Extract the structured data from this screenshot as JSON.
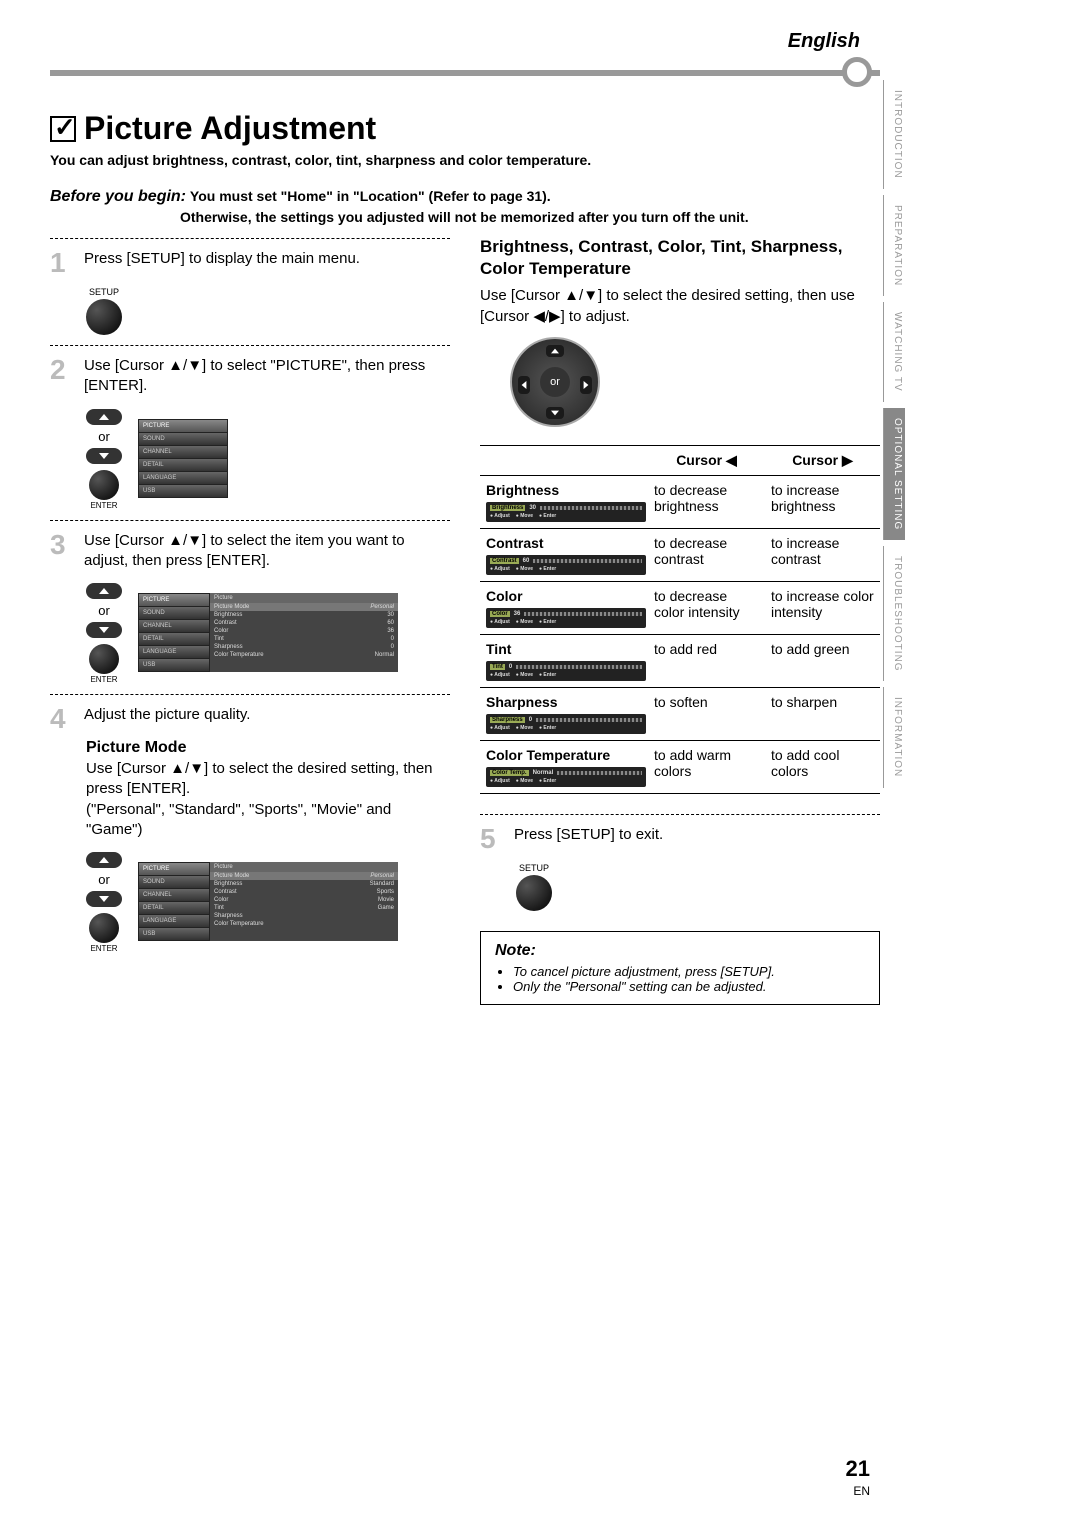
{
  "header": {
    "language": "English"
  },
  "sidebar_tabs": [
    "INTRODUCTION",
    "PREPARATION",
    "WATCHING TV",
    "OPTIONAL SETTING",
    "TROUBLESHOOTING",
    "INFORMATION"
  ],
  "sidebar_active_index": 3,
  "title": "Picture Adjustment",
  "intro": "You can adjust brightness, contrast, color, tint, sharpness and color temperature.",
  "before": {
    "lead": "Before you begin:",
    "line1": "You must set \"Home\" in \"Location\" (Refer to page 31).",
    "line2": "Otherwise, the settings you adjusted will not be memorized after you turn off the unit."
  },
  "steps": {
    "s1": "Press [SETUP] to display the main menu.",
    "s2": "Use [Cursor ▲/▼] to select \"PICTURE\", then press [ENTER].",
    "s3": "Use [Cursor ▲/▼] to select the item you want to adjust, then press [ENTER].",
    "s4": "Adjust the picture quality.",
    "s5": "Press [SETUP] to exit."
  },
  "labels": {
    "setup": "SETUP",
    "enter": "ENTER",
    "or": "or"
  },
  "menu_left_items": [
    "PICTURE",
    "SOUND",
    "CHANNEL",
    "DETAIL",
    "LANGUAGE",
    "USB"
  ],
  "picture_menu": {
    "header": "Picture",
    "rows": [
      {
        "k": "Picture Mode",
        "v": "Personal"
      },
      {
        "k": "Brightness",
        "v": "30"
      },
      {
        "k": "Contrast",
        "v": "60"
      },
      {
        "k": "Color",
        "v": "36"
      },
      {
        "k": "Tint",
        "v": "0"
      },
      {
        "k": "Sharpness",
        "v": "0"
      },
      {
        "k": "Color Temperature",
        "v": "Normal"
      }
    ]
  },
  "picture_mode_menu": {
    "header": "Picture",
    "rows": [
      {
        "k": "Picture Mode",
        "v": "Personal"
      },
      {
        "k": "Brightness",
        "v": "Standard"
      },
      {
        "k": "Contrast",
        "v": "Sports"
      },
      {
        "k": "Color",
        "v": "Movie"
      },
      {
        "k": "Tint",
        "v": "Game"
      },
      {
        "k": "Sharpness",
        "v": ""
      },
      {
        "k": "Color Temperature",
        "v": ""
      }
    ]
  },
  "picture_mode": {
    "head": "Picture Mode",
    "text1": "Use [Cursor ▲/▼] to select the desired setting, then press [ENTER].",
    "text2": "(\"Personal\", \"Standard\", \"Sports\", \"Movie\" and \"Game\")"
  },
  "sec2": {
    "head": "Brightness, Contrast, Color, Tint, Sharpness, Color Temperature",
    "text": "Use [Cursor ▲/▼] to select the desired setting, then use [Cursor ◀/▶] to adjust."
  },
  "adj_table": {
    "col_left": "Cursor ◀",
    "col_right": "Cursor ▶",
    "rows": [
      {
        "name": "Brightness",
        "val": "30",
        "left": "to decrease brightness",
        "right": "to increase brightness"
      },
      {
        "name": "Contrast",
        "val": "60",
        "left": "to decrease contrast",
        "right": "to increase contrast"
      },
      {
        "name": "Color",
        "val": "36",
        "left": "to decrease color intensity",
        "right": "to increase color intensity"
      },
      {
        "name": "Tint",
        "val": "0",
        "left": "to add red",
        "right": "to add green"
      },
      {
        "name": "Sharpness",
        "val": "0",
        "left": "to soften",
        "right": "to sharpen"
      },
      {
        "name": "Color Temperature",
        "val": "Normal",
        "left": "to add warm colors",
        "right": "to add cool colors",
        "alt": "Color Temp."
      }
    ],
    "bot_labels": [
      "Adjust",
      "Move",
      "Enter"
    ]
  },
  "note": {
    "head": "Note:",
    "items": [
      "To cancel picture adjustment, press [SETUP].",
      "Only the \"Personal\" setting can be adjusted."
    ]
  },
  "footer": {
    "page": "21",
    "lang": "EN"
  }
}
